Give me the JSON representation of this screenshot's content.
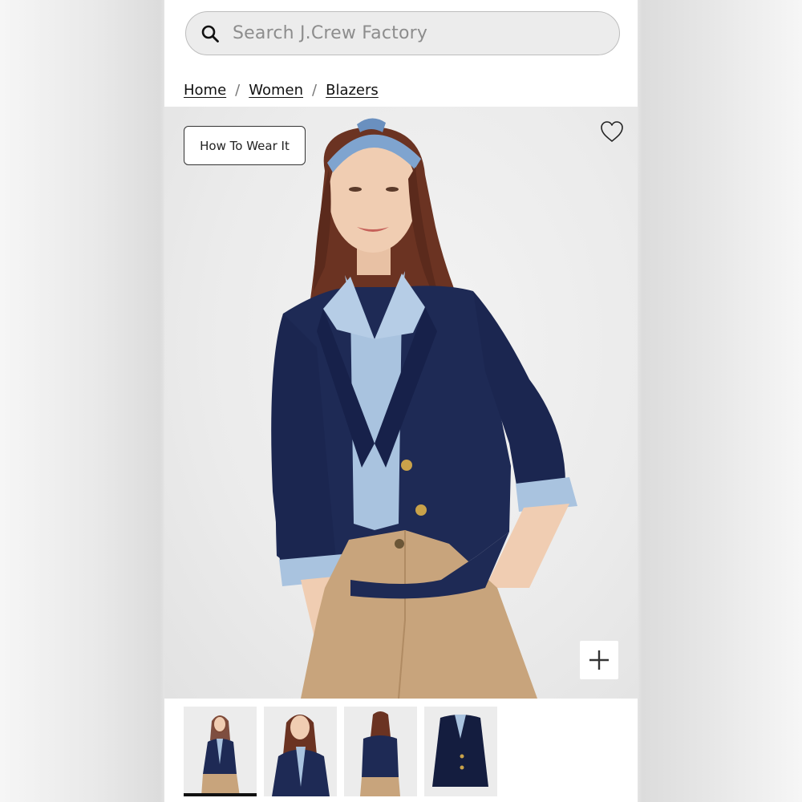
{
  "search": {
    "placeholder": "Search J.Crew Factory",
    "icon": "search-icon"
  },
  "breadcrumb": {
    "items": [
      "Home",
      "Women",
      "Blazers"
    ],
    "separator": "/"
  },
  "product_image": {
    "how_to_wear_label": "How To Wear It",
    "favorite_icon": "heart-icon",
    "zoom_icon": "plus-icon"
  },
  "thumbnails": {
    "count": 4,
    "active_index": 0
  },
  "colors": {
    "blazer": "#1e2a55",
    "shirt": "#a9c3df",
    "pants": "#c8a47c",
    "hair": "#6b3322",
    "background": "#ececec"
  }
}
